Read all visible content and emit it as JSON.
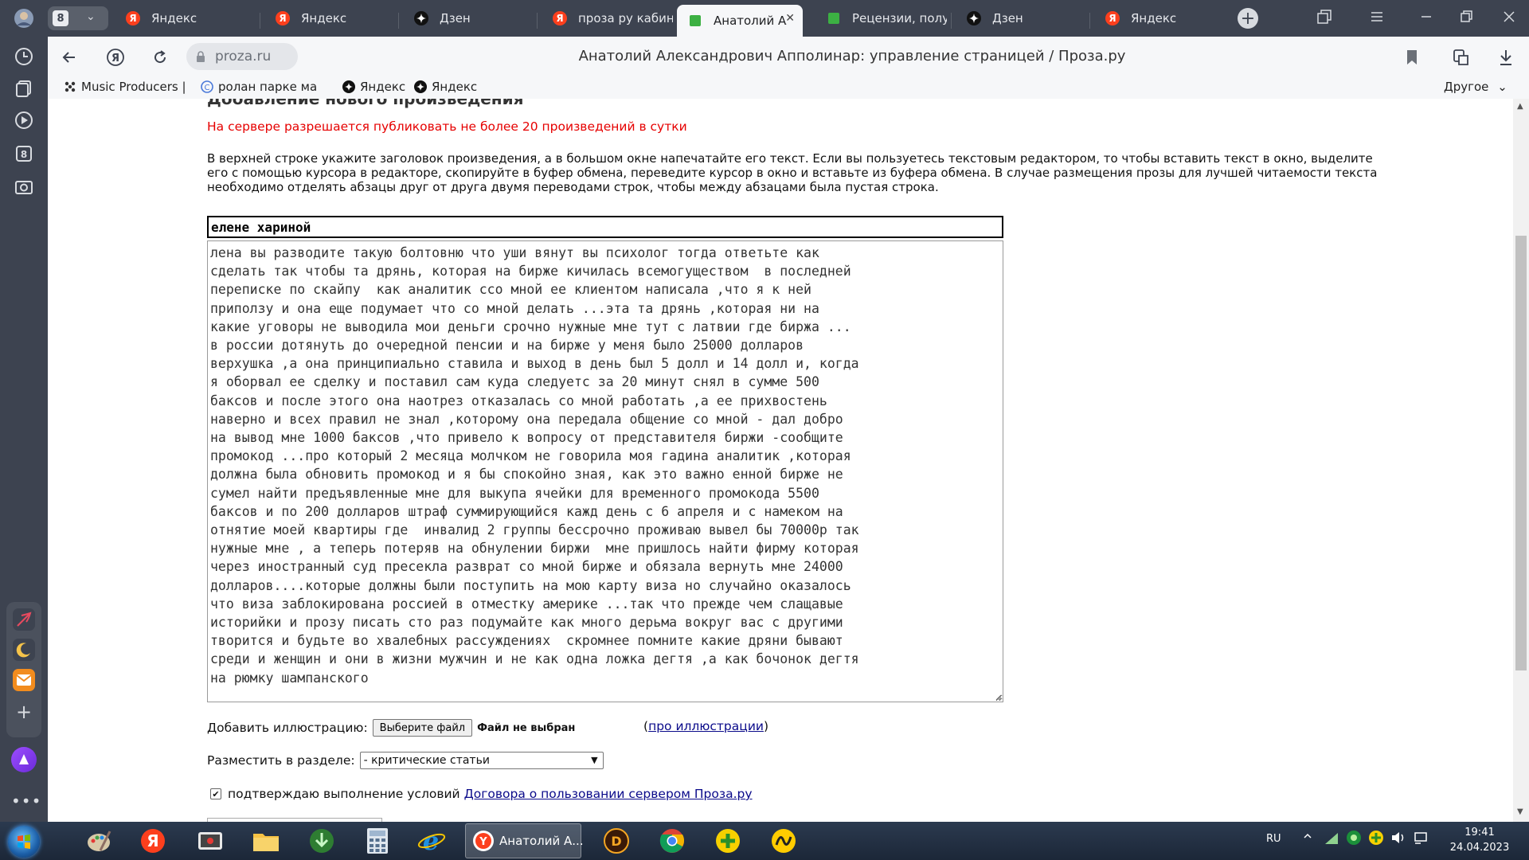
{
  "tabs": {
    "count": "8",
    "items": [
      {
        "label": "Яндекс",
        "icon": "yandex-icon"
      },
      {
        "label": "Яндекс",
        "icon": "yandex-icon"
      },
      {
        "label": "Дзен",
        "icon": "dzen-icon"
      },
      {
        "label": "проза ру кабинет",
        "icon": "yandex-icon"
      },
      {
        "label": "Анатолий Алекс",
        "icon": "proza-icon",
        "active": true
      },
      {
        "label": "Рецензии, получ",
        "icon": "proza-icon"
      },
      {
        "label": "Дзен",
        "icon": "dzen-icon"
      },
      {
        "label": "Яндекс",
        "icon": "yandex-icon"
      }
    ],
    "close_glyph": "✕"
  },
  "addressbar": {
    "domain": "proza.ru",
    "page_title": "Анатолий Александрович Апполинар: управление страницей / Проза.ру"
  },
  "bookmarks": {
    "items": [
      {
        "label": "Music Producers |"
      },
      {
        "label": "ролан парке маль"
      },
      {
        "label": "Яндекс"
      },
      {
        "label": "Яндекс"
      }
    ],
    "other": "Другое"
  },
  "page": {
    "cut_heading": "Добавление нового произведения",
    "warning": "На сервере разрешается публиковать не более 20 произведений в сутки",
    "instructions": "В верхней строке укажите заголовок произведения, а в большом окне напечатайте его текст. Если вы пользуетесь текстовым редактором, то чтобы вставить текст в окно, выделите его с помощью курсора в редакторе, скопируйте в буфер обмена, переведите курсор в окно и вставьте из буфера обмена. В случае размещения прозы для лучшей читаемости текста необходимо отделять абзацы друг от друга двумя переводами строк, чтобы между абзацами была пустая строка.",
    "title_value": "елене хариной",
    "body_value": "лена вы разводите такую болтовню что уши вянут вы психолог тогда ответьте как\nсделать так чтобы та дрянь, которая на бирже кичилась всемогуществом  в последней\nпереписке по скайпу  как аналитик ссо мной ее клиентом написала ,что я к ней\nприползу и она еще подумает что со мной делать ...эта та дрянь ,которая ни на\nкакие уговоры не выводила мои деньги срочно нужные мне тут с латвии где биржа ...\nв россии дотянуть до очередной пенсии и на бирже у меня было 25000 долларов\nверхушка ,а она принципиально ставила и выход в день был 5 долл и 14 долл и, когда\nя оборвал ее сделку и поставил сам куда следуетс за 20 минут снял в сумме 500\nбаксов и после этого она наотрез отказалась со мной работать ,а ее прихвостень\nнаверно и всех правил не знал ,которому она передала общение со мной - дал добро\nна вывод мне 1000 баксов ,что привело к вопросу от представителя биржи -сообщите\nпромокод ...про который 2 месяца молчком не говорила моя гадина аналитик ,которая\nдолжна была обновить промокод и я бы спокойно зная, как это важно енной бирже не\nсумел найти предъявленные мне для выкупа ячейки для временного промокода 5500\nбаксов и по 200 долларов штраф суммирующийся кажд день с 6 апреля и с намеком на\nотнятие моей квартиры где  инвалид 2 группы бессрочно проживаю вывел бы 70000р так\nнужные мне , а теперь потеряв на обнулении биржи  мне пришлось найти фирму которая\nчерез иностранный суд пресекла разврат со мной бирже и обязала вернуть мне 24000\nдолларов....которые должны были поступить на мою карту виза но случайно оказалось\nчто виза заблокирована россией в отместку америке ...так что прежде чем слащавые\nисторийки и прозу писать сто раз подумайте как много дерьма вокруг вас с другими\nтворится и будьте во хвалебных рассуждениях  скромнее помните какие дряни бывают\nсреди и женщин и они в жизни мужчин и не как одна ложка дегтя ,а как бочонок дегтя\nна рюмку шампанского",
    "illus_label": "Добавить иллюстрацию:",
    "file_button": "Выберите файл",
    "no_file": "Файл не выбран",
    "illus_link_open": "(",
    "illus_link": "про иллюстрации",
    "illus_link_close": ")",
    "section_label": "Разместить в разделе:",
    "section_value": "- критические статьи",
    "agree_text": "подтверждаю выполнение условий",
    "agree_link": "Договора о пользовании сервером Проза.ру",
    "agree_checked": true
  },
  "taskbar": {
    "active_window": "Анатолий А...",
    "lang": "RU",
    "time": "19:41",
    "date": "24.04.2023"
  },
  "colors": {
    "chrome_dark": "#3d4350",
    "warning_red": "#e60000",
    "link_blue": "#0a0a8a",
    "yandex_red": "#fc3f1d"
  }
}
